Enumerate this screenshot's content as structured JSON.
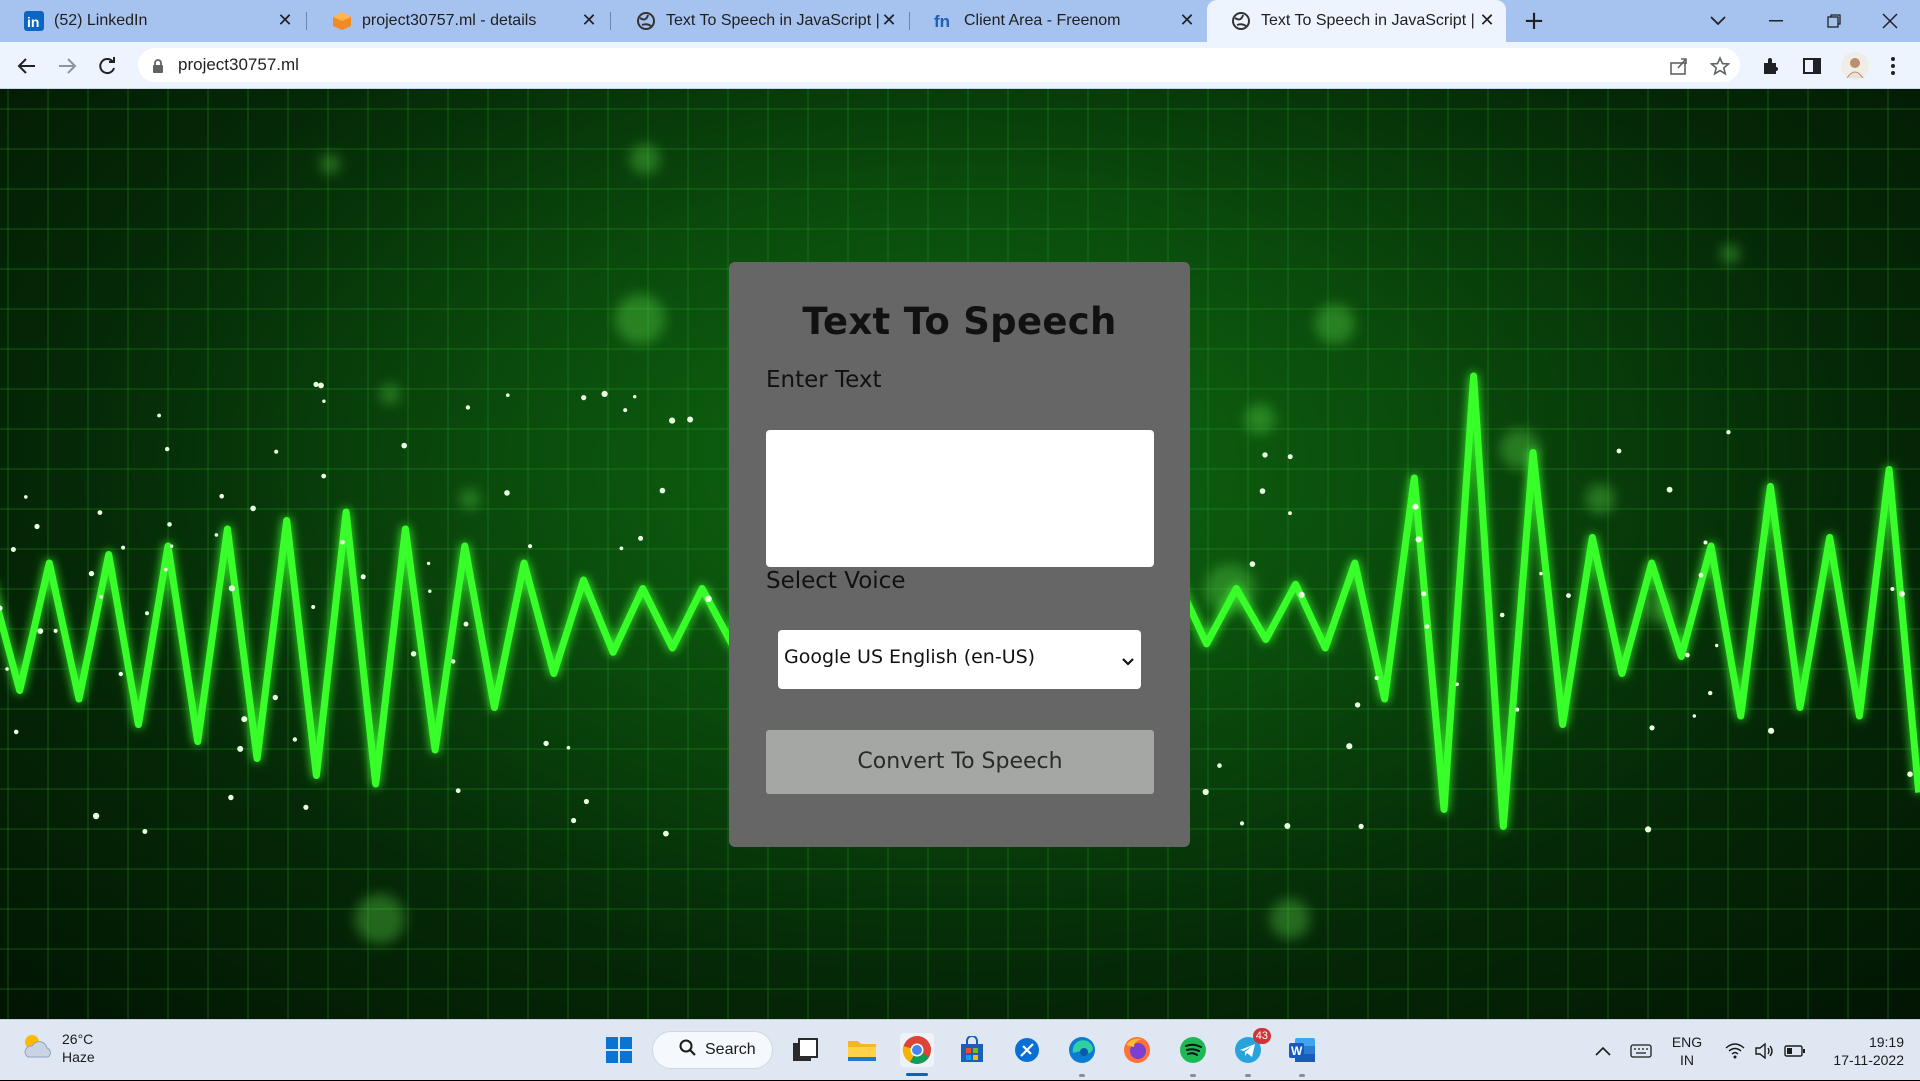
{
  "browser": {
    "tabs": [
      {
        "title": "(52) LinkedIn",
        "icon": "linkedin-icon",
        "active": false
      },
      {
        "title": "project30757.ml - details",
        "icon": "box-icon",
        "active": false
      },
      {
        "title": "Text To Speech in JavaScript | Cod",
        "icon": "globe-icon",
        "active": false
      },
      {
        "title": "Client Area - Freenom",
        "icon": "freenom-icon",
        "active": false
      },
      {
        "title": "Text To Speech in JavaScript | Coc",
        "icon": "globe-icon",
        "active": true
      }
    ],
    "url": "project30757.ml"
  },
  "page": {
    "heading": "Text To Speech",
    "text_label": "Enter Text",
    "text_value": "",
    "voice_label": "Select Voice",
    "voice_selected": "Google US English (en-US)",
    "button_label": "Convert To Speech"
  },
  "taskbar": {
    "weather_temp": "26°C",
    "weather_desc": "Haze",
    "search_label": "Search",
    "telegram_badge": "43",
    "lang_top": "ENG",
    "lang_bottom": "IN",
    "time": "19:19",
    "date": "17-11-2022"
  },
  "colors": {
    "tabstrip": "#a6c2ee",
    "active_tab": "#eef4fd",
    "card": "#666666",
    "button": "#a4a7a4",
    "wave": "#39ff2a",
    "taskbar": "#dfe8f2"
  }
}
